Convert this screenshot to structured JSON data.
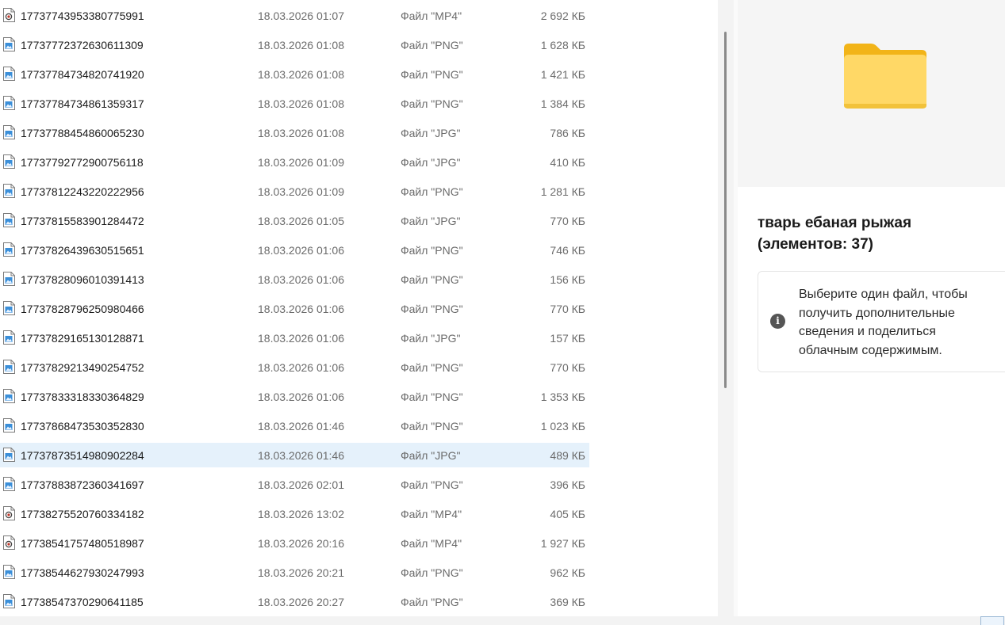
{
  "files": [
    {
      "name": "17737743953380775991",
      "date": "18.03.2026 01:07",
      "type": "Файл \"MP4\"",
      "size": "2 692 КБ",
      "icon": "video-file-icon"
    },
    {
      "name": "17737772372630611309",
      "date": "18.03.2026 01:08",
      "type": "Файл \"PNG\"",
      "size": "1 628 КБ",
      "icon": "image-file-icon"
    },
    {
      "name": "17737784734820741920",
      "date": "18.03.2026 01:08",
      "type": "Файл \"PNG\"",
      "size": "1 421 КБ",
      "icon": "image-file-icon"
    },
    {
      "name": "17737784734861359317",
      "date": "18.03.2026 01:08",
      "type": "Файл \"PNG\"",
      "size": "1 384 КБ",
      "icon": "image-file-icon"
    },
    {
      "name": "17737788454860065230",
      "date": "18.03.2026 01:08",
      "type": "Файл \"JPG\"",
      "size": "786 КБ",
      "icon": "image-file-icon"
    },
    {
      "name": "17737792772900756118",
      "date": "18.03.2026 01:09",
      "type": "Файл \"JPG\"",
      "size": "410 КБ",
      "icon": "image-file-icon"
    },
    {
      "name": "17737812243220222956",
      "date": "18.03.2026 01:09",
      "type": "Файл \"PNG\"",
      "size": "1 281 КБ",
      "icon": "image-file-icon"
    },
    {
      "name": "17737815583901284472",
      "date": "18.03.2026 01:05",
      "type": "Файл \"JPG\"",
      "size": "770 КБ",
      "icon": "image-file-icon"
    },
    {
      "name": "17737826439630515651",
      "date": "18.03.2026 01:06",
      "type": "Файл \"PNG\"",
      "size": "746 КБ",
      "icon": "image-file-icon"
    },
    {
      "name": "17737828096010391413",
      "date": "18.03.2026 01:06",
      "type": "Файл \"PNG\"",
      "size": "156 КБ",
      "icon": "image-file-icon"
    },
    {
      "name": "17737828796250980466",
      "date": "18.03.2026 01:06",
      "type": "Файл \"PNG\"",
      "size": "770 КБ",
      "icon": "image-file-icon"
    },
    {
      "name": "17737829165130128871",
      "date": "18.03.2026 01:06",
      "type": "Файл \"JPG\"",
      "size": "157 КБ",
      "icon": "image-file-icon"
    },
    {
      "name": "17737829213490254752",
      "date": "18.03.2026 01:06",
      "type": "Файл \"PNG\"",
      "size": "770 КБ",
      "icon": "image-file-icon"
    },
    {
      "name": "17737833318330364829",
      "date": "18.03.2026 01:06",
      "type": "Файл \"PNG\"",
      "size": "1 353 КБ",
      "icon": "image-file-icon"
    },
    {
      "name": "17737868473530352830",
      "date": "18.03.2026 01:46",
      "type": "Файл \"PNG\"",
      "size": "1 023 КБ",
      "icon": "image-file-icon"
    },
    {
      "name": "17737873514980902284",
      "date": "18.03.2026 01:46",
      "type": "Файл \"JPG\"",
      "size": "489 КБ",
      "icon": "image-file-icon",
      "selected": true
    },
    {
      "name": "17737883872360341697",
      "date": "18.03.2026 02:01",
      "type": "Файл \"PNG\"",
      "size": "396 КБ",
      "icon": "image-file-icon"
    },
    {
      "name": "17738275520760334182",
      "date": "18.03.2026 13:02",
      "type": "Файл \"MP4\"",
      "size": "405 КБ",
      "icon": "video-file-icon"
    },
    {
      "name": "17738541757480518987",
      "date": "18.03.2026 20:16",
      "type": "Файл \"MP4\"",
      "size": "1 927 КБ",
      "icon": "video-file-icon"
    },
    {
      "name": "17738544627930247993",
      "date": "18.03.2026 20:21",
      "type": "Файл \"PNG\"",
      "size": "962 КБ",
      "icon": "image-file-icon"
    },
    {
      "name": "17738547370290641185",
      "date": "18.03.2026 20:27",
      "type": "Файл \"PNG\"",
      "size": "369 КБ",
      "icon": "image-file-icon"
    }
  ],
  "preview": {
    "folder_icon": "folder-icon",
    "title": "тварь ебаная рыжая (элементов: 37)",
    "info_icon": "info-icon",
    "info_text": "Выберите один файл, чтобы получить дополнительные сведения и поделиться облачным содержимым."
  },
  "colors": {
    "selection": "#e5f1fb",
    "folder_front": "#ffd866",
    "folder_back": "#f2b418",
    "muted_text": "#6b6b6b"
  }
}
